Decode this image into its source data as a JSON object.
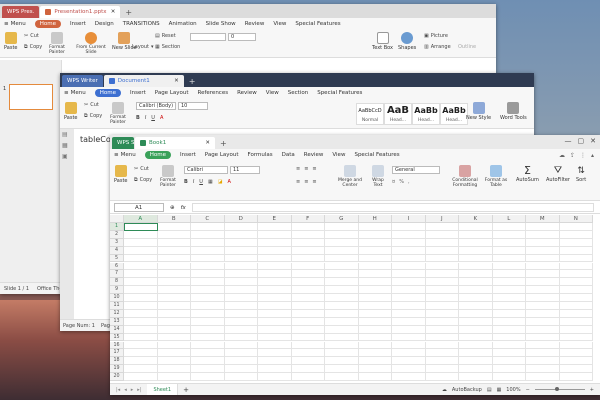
{
  "colors": {
    "ppt_accent": "#c0504d",
    "doc_accent": "#3d6fd1",
    "xl_accent": "#2e8b57"
  },
  "ppt": {
    "app_tab": "WPS Pres.",
    "doc_tab": "Presentation1.pptx",
    "menu": [
      "Menu",
      "Home",
      "Insert",
      "Design",
      "TRANSITIONS",
      "Animation",
      "Slide Show",
      "Review",
      "View",
      "Special Features"
    ],
    "ribbon": {
      "paste": "Paste",
      "cut": "Cut",
      "copy": "Copy",
      "format_painter": "Format Painter",
      "from_current": "From Current Slide",
      "new_slide": "New Slide",
      "layout": "Layout",
      "reset": "Reset",
      "section": "Section",
      "text_box": "Text Box",
      "shapes": "Shapes",
      "picture": "Picture",
      "arrange": "Arrange",
      "outline": "Outline"
    },
    "font_size_value": "0",
    "status": {
      "slide": "Slide 1 / 1",
      "theme": "Office Theme"
    }
  },
  "doc": {
    "app_tab": "WPS Writer",
    "doc_tab": "Document1",
    "menu": [
      "Menu",
      "Home",
      "Insert",
      "Page Layout",
      "References",
      "Review",
      "View",
      "Section",
      "Special Features"
    ],
    "ribbon": {
      "paste": "Paste",
      "cut": "Cut",
      "copy": "Copy",
      "format_painter": "Format Painter",
      "new_style": "New Style",
      "word_tools": "Word Tools"
    },
    "font_name": "Calibri (Body)",
    "font_size": "10",
    "styles": [
      {
        "preview": "AaBbCcD",
        "label": "Normal"
      },
      {
        "preview": "AaB",
        "label": "Head..."
      },
      {
        "preview": "AaBb",
        "label": "Head..."
      },
      {
        "preview": "AaBb",
        "label": "Head..."
      }
    ],
    "body_text": "tableCont",
    "status": {
      "page": "Page Num: 1",
      "pages": "Page"
    }
  },
  "xl": {
    "app_tab": "WPS Spreadsheets",
    "doc_tab": "Book1",
    "menu": [
      "Menu",
      "Home",
      "Insert",
      "Page Layout",
      "Formulas",
      "Data",
      "Review",
      "View",
      "Special Features"
    ],
    "ribbon": {
      "paste": "Paste",
      "cut": "Cut",
      "copy": "Copy",
      "format_painter": "Format Painter",
      "merge_center": "Merge and Center",
      "wrap_text": "Wrap Text",
      "conditional": "Conditional Formatting",
      "format_table": "Format as Table",
      "autosum": "AutoSum",
      "autofilter": "AutoFilter",
      "sort": "Sort"
    },
    "font_name": "Calibri",
    "font_size": "11",
    "number_format": "General",
    "name_box": "A1",
    "fx": "fx",
    "columns": [
      "A",
      "B",
      "C",
      "D",
      "E",
      "F",
      "G",
      "H",
      "I",
      "J",
      "K",
      "L",
      "M",
      "N"
    ],
    "rows": [
      "1",
      "2",
      "3",
      "4",
      "5",
      "6",
      "7",
      "8",
      "9",
      "10",
      "11",
      "12",
      "13",
      "14",
      "15",
      "16",
      "17",
      "18",
      "19",
      "20"
    ],
    "sheet_tab": "Sheet1",
    "sheet_add": "+",
    "autobackup": "AutoBackup",
    "zoom": "100%"
  }
}
